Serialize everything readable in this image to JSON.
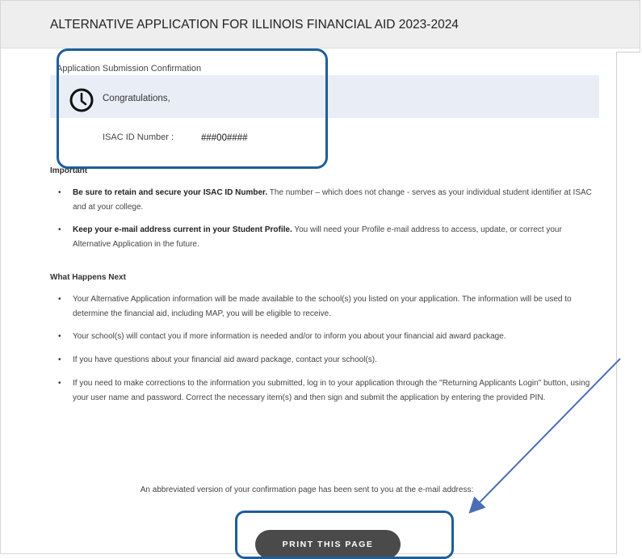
{
  "page": {
    "title": "ALTERNATIVE APPLICATION FOR ILLINOIS FINANCIAL AID 2023-2024"
  },
  "confirmation": {
    "heading": "Application Submission Confirmation",
    "congrats": "Congratulations,",
    "id_label": "ISAC ID Number :",
    "id_value": "###00####",
    "icon": "clock-icon"
  },
  "important": {
    "heading": "Important",
    "items": [
      {
        "bold": "Be sure to retain and secure your ISAC ID Number.",
        "text": " The number – which does not change - serves as your individual student identifier at ISAC and at your college."
      },
      {
        "bold": "Keep your e-mail address current in your Student Profile.",
        "text": " You will need your Profile e-mail address to access, update, or correct your Alternative Application in the future."
      }
    ]
  },
  "next": {
    "heading": "What Happens Next",
    "items": [
      "Your Alternative Application information will be made available to the school(s) you listed on your application. The information will be used to determine the financial aid, including MAP, you will be eligible to receive.",
      "Your school(s) will contact you if more information is needed and/or to inform you about your financial aid award package.",
      "If you have questions about your financial aid award package, contact your school(s).",
      "If you need to make corrections to the information you submitted, log in to your application through the \"Returning Applicants Login\" button, using your user name and password. Correct the necessary item(s) and then sign and submit the application by entering the provided PIN."
    ]
  },
  "footer": {
    "abbrev_text": "An abbreviated version of your confirmation page has been sent to you at the e-mail address:",
    "print_label": "PRINT THIS PAGE"
  },
  "colors": {
    "annotation": "#1f5e99",
    "button": "#4a4a4a",
    "panel": "#e9eef6"
  }
}
